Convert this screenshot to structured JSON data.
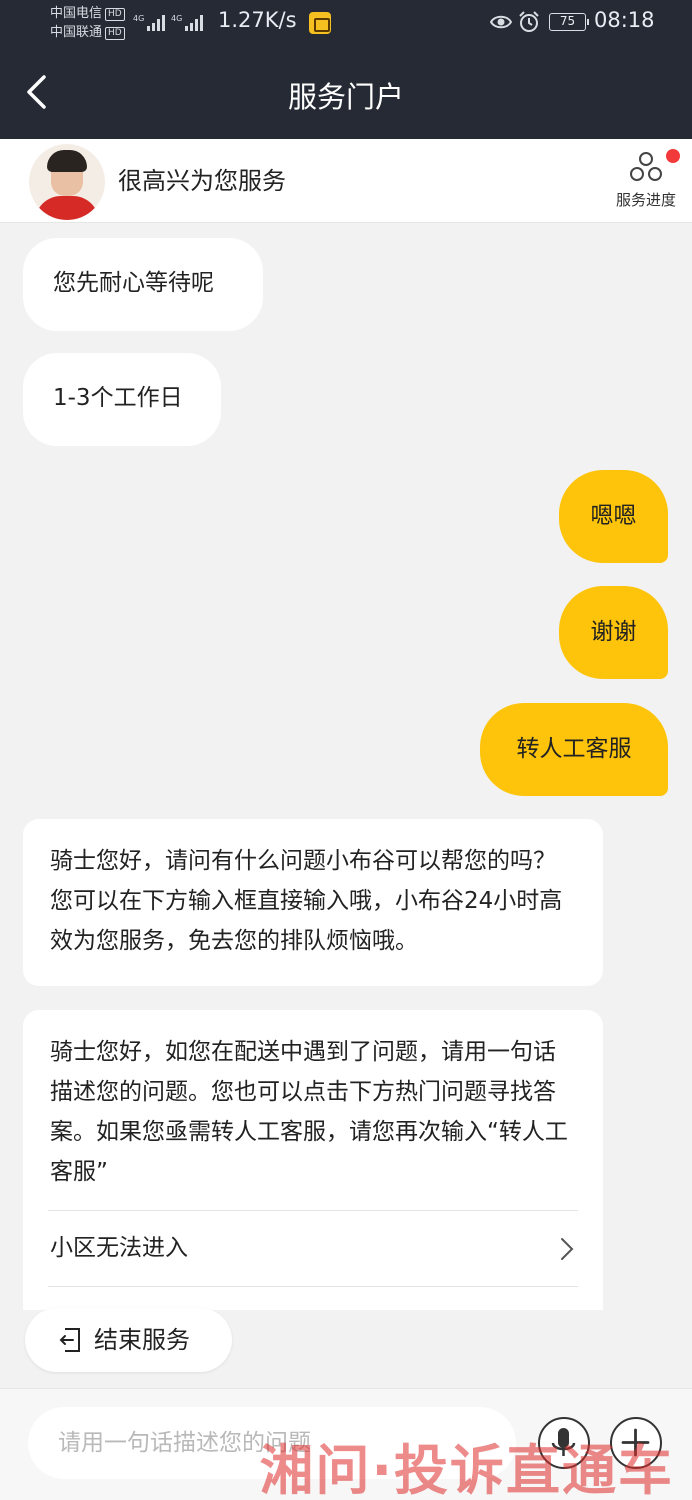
{
  "status_bar": {
    "carrier1": "中国电信",
    "carrier2": "中国联通",
    "hd": "HD",
    "network": "4G",
    "speed": "1.27K/s",
    "battery": "75",
    "time": "08:18"
  },
  "header": {
    "title": "服务门户"
  },
  "agent": {
    "greeting": "很高兴为您服务",
    "progress_label": "服务进度"
  },
  "messages": {
    "agent_short_1": "您先耐心等待呢",
    "agent_short_2": "1-3个工作日",
    "user_1": "嗯嗯",
    "user_2": "谢谢",
    "user_3": "转人工客服",
    "agent_long_1": "骑士您好，请问有什么问题小布谷可以帮您的吗？您可以在下方输入框直接输入哦，小布谷24小时高效为您服务，免去您的排队烦恼哦。",
    "agent_long_2": "骑士您好，如您在配送中遇到了问题，请用一句话描述您的问题。您也可以点击下方热门问题寻找答案。如果您亟需转人工客服，请您再次输入“转人工客服”",
    "faq_1": "小区无法进入"
  },
  "bottom": {
    "end_service": "结束服务",
    "input_placeholder": "请用一句话描述您的问题"
  },
  "watermark": "湘问·投诉直通车",
  "colors": {
    "header_bg": "#252a34",
    "user_bubble": "#fdc40b",
    "badge": "#f23a3a"
  }
}
